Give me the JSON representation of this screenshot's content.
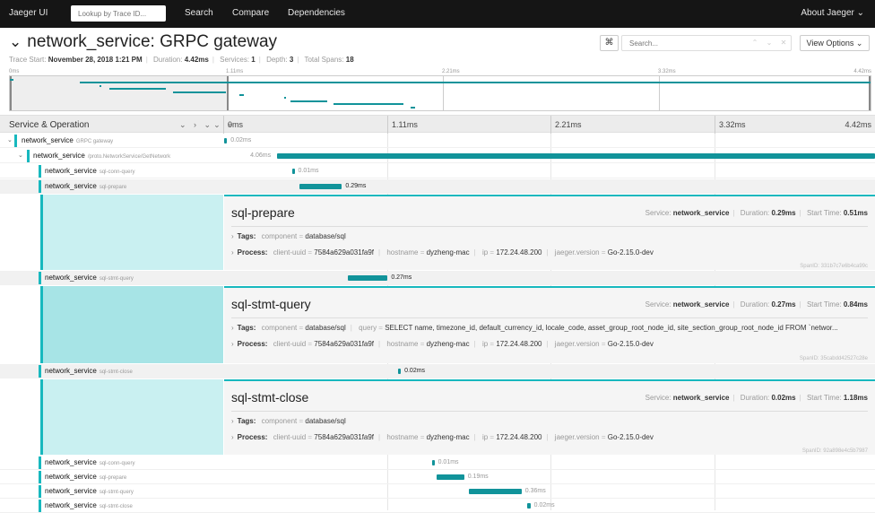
{
  "nav": {
    "brand": "Jaeger UI",
    "lookup_placeholder": "Lookup by Trace ID...",
    "search": "Search",
    "compare": "Compare",
    "dependencies": "Dependencies",
    "about": "About Jaeger ⌄"
  },
  "header": {
    "title": "network_service: GRPC gateway",
    "trace_start_label": "Trace Start:",
    "trace_start": "November 28, 2018 1:21 PM",
    "duration_label": "Duration:",
    "duration": "4.42ms",
    "services_label": "Services:",
    "services": "1",
    "depth_label": "Depth:",
    "depth": "3",
    "total_spans_label": "Total Spans:",
    "total_spans": "18",
    "kbd_icon": "⌘",
    "search_placeholder": "Search...",
    "view_options": "View Options ⌄"
  },
  "minimap": {
    "ticks": [
      "0ms",
      "1.11ms",
      "2.21ms",
      "3.32ms",
      "4.42ms"
    ]
  },
  "table": {
    "service_operation": "Service & Operation",
    "expanders": "⌄ › ⌄⌄ »",
    "ticks": [
      "0ms",
      "1.11ms",
      "2.21ms",
      "3.32ms",
      "4.42ms"
    ]
  },
  "spans": [
    {
      "service": "network_service",
      "op": "GRPC gateway",
      "duration": "0.02ms",
      "start_ms": 0.0,
      "dur_ms": 0.02
    },
    {
      "service": "network_service",
      "op": "/proto.NetworkService/GetNetwork",
      "duration": "4.06ms",
      "start_ms": 0.36,
      "dur_ms": 4.06
    },
    {
      "service": "network_service",
      "op": "sql-conn-query",
      "duration": "0.01ms",
      "start_ms": 0.46,
      "dur_ms": 0.01
    },
    {
      "service": "network_service",
      "op": "sql-prepare",
      "duration": "0.29ms",
      "start_ms": 0.51,
      "dur_ms": 0.29
    },
    {
      "service": "network_service",
      "op": "sql-stmt-query",
      "duration": "0.27ms",
      "start_ms": 0.84,
      "dur_ms": 0.27
    },
    {
      "service": "network_service",
      "op": "sql-stmt-close",
      "duration": "0.02ms",
      "start_ms": 1.18,
      "dur_ms": 0.02
    },
    {
      "service": "network_service",
      "op": "sql-conn-query",
      "duration": "0.01ms",
      "start_ms": 1.41,
      "dur_ms": 0.01
    },
    {
      "service": "network_service",
      "op": "sql-prepare",
      "duration": "0.19ms",
      "start_ms": 1.44,
      "dur_ms": 0.19
    },
    {
      "service": "network_service",
      "op": "sql-stmt-query",
      "duration": "0.36ms",
      "start_ms": 1.66,
      "dur_ms": 0.36
    },
    {
      "service": "network_service",
      "op": "sql-stmt-close",
      "duration": "0.02ms",
      "start_ms": 2.06,
      "dur_ms": 0.02
    }
  ],
  "details": [
    {
      "title": "sql-prepare",
      "service_label": "Service:",
      "service": "network_service",
      "duration_label": "Duration:",
      "duration": "0.29ms",
      "start_label": "Start Time:",
      "start": "0.51ms",
      "tags_label": "Tags:",
      "tags": [
        {
          "k": "component",
          "v": "database/sql"
        }
      ],
      "process_label": "Process:",
      "process": [
        {
          "k": "client-uuid",
          "v": "7584a629a031fa9f"
        },
        {
          "k": "hostname",
          "v": "dyzheng-mac"
        },
        {
          "k": "ip",
          "v": "172.24.48.200"
        },
        {
          "k": "jaeger.version",
          "v": "Go-2.15.0-dev"
        }
      ],
      "span_id": "SpanID: 331b7c7e6b4ca99c"
    },
    {
      "title": "sql-stmt-query",
      "service_label": "Service:",
      "service": "network_service",
      "duration_label": "Duration:",
      "duration": "0.27ms",
      "start_label": "Start Time:",
      "start": "0.84ms",
      "tags_label": "Tags:",
      "tags": [
        {
          "k": "component",
          "v": "database/sql"
        },
        {
          "k": "query",
          "v": "SELECT name, timezone_id, default_currency_id, locale_code, asset_group_root_node_id, site_section_group_root_node_id FROM `networ..."
        }
      ],
      "process_label": "Process:",
      "process": [
        {
          "k": "client-uuid",
          "v": "7584a629a031fa9f"
        },
        {
          "k": "hostname",
          "v": "dyzheng-mac"
        },
        {
          "k": "ip",
          "v": "172.24.48.200"
        },
        {
          "k": "jaeger.version",
          "v": "Go-2.15.0-dev"
        }
      ],
      "span_id": "SpanID: 35cabdd42527c28e"
    },
    {
      "title": "sql-stmt-close",
      "service_label": "Service:",
      "service": "network_service",
      "duration_label": "Duration:",
      "duration": "0.02ms",
      "start_label": "Start Time:",
      "start": "1.18ms",
      "tags_label": "Tags:",
      "tags": [
        {
          "k": "component",
          "v": "database/sql"
        }
      ],
      "process_label": "Process:",
      "process": [
        {
          "k": "client-uuid",
          "v": "7584a629a031fa9f"
        },
        {
          "k": "hostname",
          "v": "dyzheng-mac"
        },
        {
          "k": "ip",
          "v": "172.24.48.200"
        },
        {
          "k": "jaeger.version",
          "v": "Go-2.15.0-dev"
        }
      ],
      "span_id": "SpanID: 92a898e4c5b7987"
    }
  ],
  "colors": {
    "accent": "#17b8be",
    "bar": "#11939a",
    "nav": "#151515"
  }
}
